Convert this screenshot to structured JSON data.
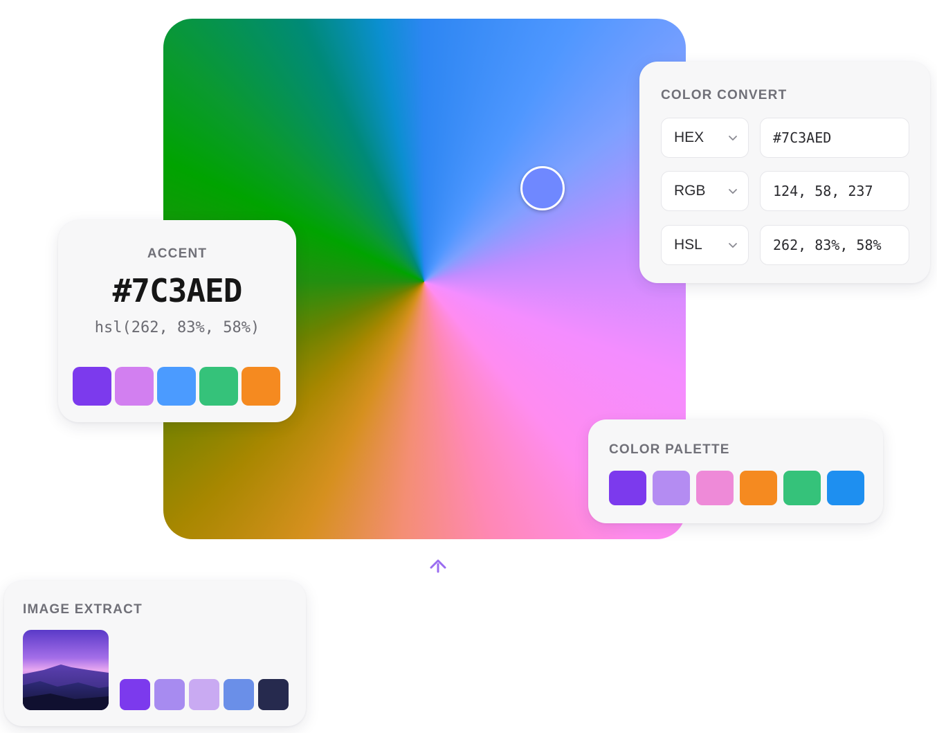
{
  "accent": {
    "title": "ACCENT",
    "hex": "#7C3AED",
    "hsl": "hsl(262, 83%, 58%)",
    "swatches": [
      "#7c3aed",
      "#d27ff0",
      "#4b9bff",
      "#35c27a",
      "#f58a20"
    ]
  },
  "color_convert": {
    "title": "COLOR CONVERT",
    "rows": [
      {
        "format": "HEX",
        "value": "#7C3AED"
      },
      {
        "format": "RGB",
        "value": "124, 58, 237"
      },
      {
        "format": "HSL",
        "value": "262, 83%, 58%"
      }
    ]
  },
  "color_palette": {
    "title": "COLOR PALETTE",
    "swatches": [
      "#7c3aed",
      "#b48cf2",
      "#ee8ad8",
      "#f58a20",
      "#35c27a",
      "#1e8ff0"
    ]
  },
  "image_extract": {
    "title": "IMAGE EXTRACT",
    "swatches": [
      "#7c3aed",
      "#a78bf0",
      "#c9aaf2",
      "#6a8fe8",
      "#262a4e"
    ]
  },
  "picker": {
    "handle_color": "#6f88ff"
  }
}
